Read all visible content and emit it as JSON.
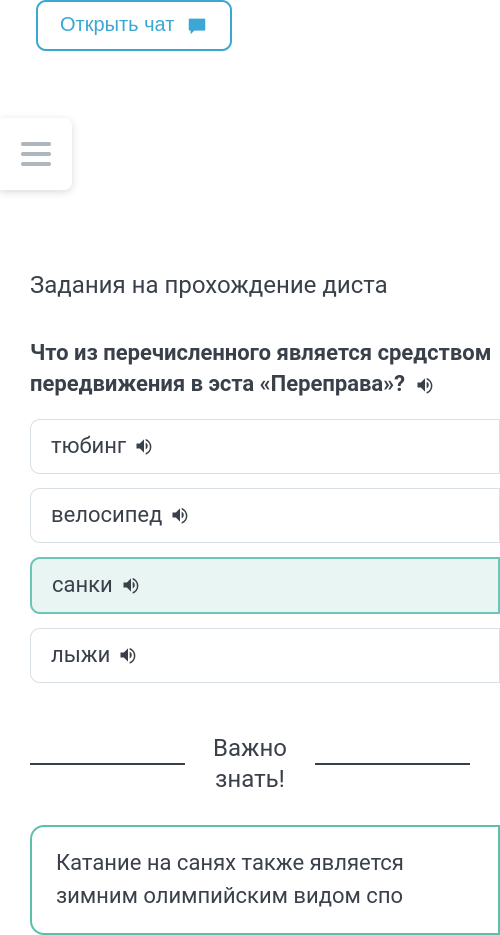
{
  "chat": {
    "label": "Открыть чат"
  },
  "section_title": "Задания на прохождение диста",
  "question": {
    "text": "Что из перечисленного является средством передвижения в эста «Переправа»?"
  },
  "answers": [
    {
      "label": "тюбинг",
      "selected": false
    },
    {
      "label": "велосипед",
      "selected": false
    },
    {
      "label": "санки",
      "selected": true
    },
    {
      "label": "лыжи",
      "selected": false
    }
  ],
  "divider": {
    "label_line1": "Важно",
    "label_line2": "знать!"
  },
  "info_box": {
    "text": "Катание на санях также является зимним олимпийским видом спо"
  }
}
